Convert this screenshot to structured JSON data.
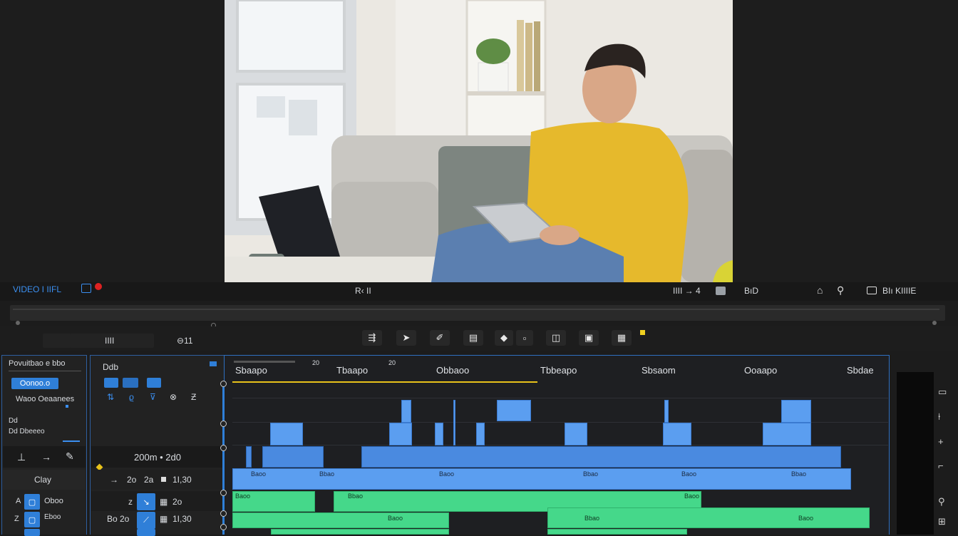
{
  "viewer": {
    "header_left": "VIDEO I IIFL",
    "header_center": "R‹ II",
    "header_right_1": "IIII → 4",
    "header_right_2": "BıD",
    "header_right_3": "BIı KIIIIE",
    "record_badge": "●"
  },
  "transport": {
    "timecode": "IIII",
    "speed": "⊖11",
    "tools": [
      "⇶",
      "➤",
      "✐",
      "▤",
      "◆",
      "▫",
      "◫",
      "▣",
      "▦"
    ]
  },
  "left_panel": {
    "title": "Povuitbao e bbo",
    "chip": "Oonoo.o",
    "subtitle": "Waoo Oeaanees",
    "row1": "Dd",
    "row2": "Dd Dbeeeo",
    "clay": "Clay",
    "track_a": "Oboo",
    "track_b": "Eboo"
  },
  "mid_panel": {
    "title": "Ddb",
    "zoom": "200m • 2d0",
    "row1_a": "2o",
    "row1_b": "2a",
    "row1_c": "1I,30",
    "row2_a": "z",
    "row2_b": "2o",
    "row3_a": "Bo 2o",
    "row3_b": "1I,30"
  },
  "timeline": {
    "ruler_start": "20",
    "ruler_labels": [
      "Sbaapo",
      "Tbaapo",
      "Obbaoo",
      "Tbbeapo",
      "Sbsaom",
      "Ooaapo",
      "Sbdae"
    ],
    "clip_label": "Baoo",
    "clip_label_2": "Bbao"
  },
  "colors": {
    "accent": "#2f7fd8",
    "clip_blue": "#5b9ef0",
    "clip_green": "#45d88a",
    "playhead": "#e8c21a"
  }
}
